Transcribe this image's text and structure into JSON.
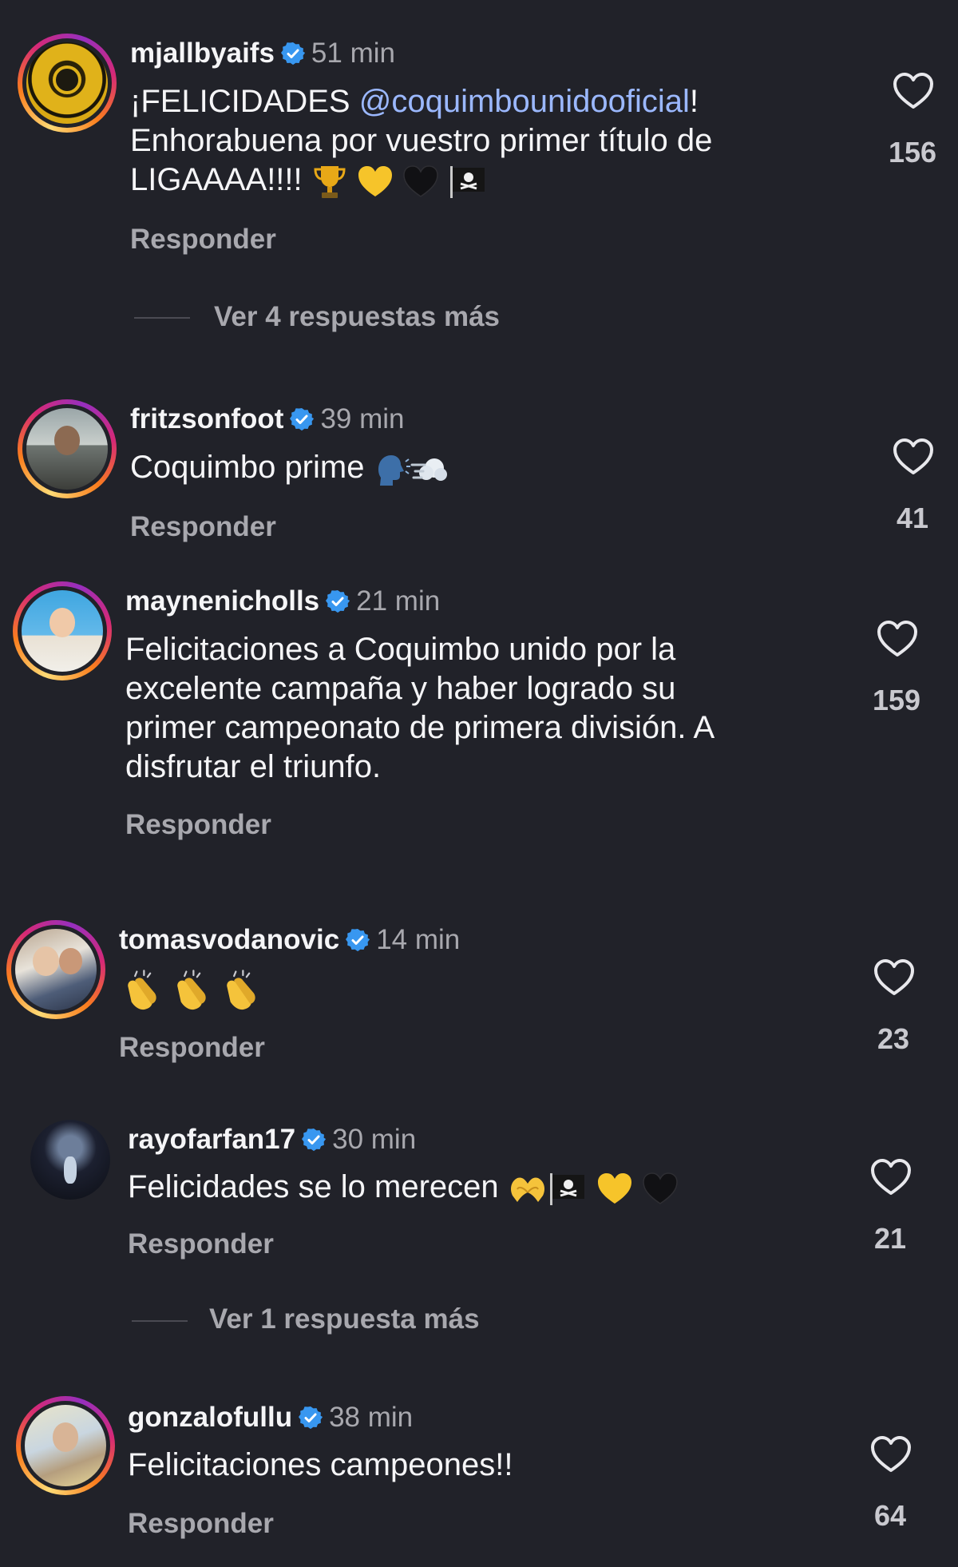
{
  "comments": [
    {
      "username": "mjallbyaifs",
      "time": "51 min",
      "text_before": "¡FELICIDADES ",
      "mention": "@coquimbounidooficial",
      "text_after": "!",
      "line2": "Enhorabuena por vuestro primer título de",
      "line3": "LIGAAAA!!!!",
      "emoji": [
        "trophy",
        "yellow-heart",
        "black-heart",
        "pirate-flag"
      ],
      "reply_label": "Responder",
      "likes": "156"
    },
    {
      "username": "fritzsonfoot",
      "time": "39 min",
      "text": "Coquimbo prime",
      "emoji": [
        "speaking-head",
        "dash"
      ],
      "reply_label": "Responder",
      "likes": "41"
    },
    {
      "username": "maynenicholls",
      "time": "21 min",
      "lines": [
        "Felicitaciones a Coquimbo unido por la",
        "excelente campaña y haber logrado su",
        "primer campeonato de primera división. A",
        "disfrutar el triunfo."
      ],
      "reply_label": "Responder",
      "likes": "159"
    },
    {
      "username": "tomasvodanovic",
      "time": "14 min",
      "emoji": [
        "clap",
        "clap",
        "clap"
      ],
      "reply_label": "Responder",
      "likes": "23"
    },
    {
      "username": "rayofarfan17",
      "time": "30 min",
      "text": "Felicidades  se lo merecen",
      "emoji": [
        "heart-hands",
        "pirate-flag",
        "yellow-heart",
        "black-heart"
      ],
      "reply_label": "Responder",
      "likes": "21"
    },
    {
      "username": "gonzalofullu",
      "time": "38 min",
      "text": "Felicitaciones campeones!!",
      "reply_label": "Responder",
      "likes": "64"
    }
  ],
  "view_more": [
    "Ver 4 respuestas más",
    "Ver 1 respuesta más"
  ],
  "colors": {
    "background": "#212229",
    "verified": "#3897f0",
    "mention": "#9bb8ff",
    "muted": "#a8a8ae"
  },
  "icons": {
    "like": "heart-outline-icon",
    "verified": "verified-badge-icon"
  }
}
